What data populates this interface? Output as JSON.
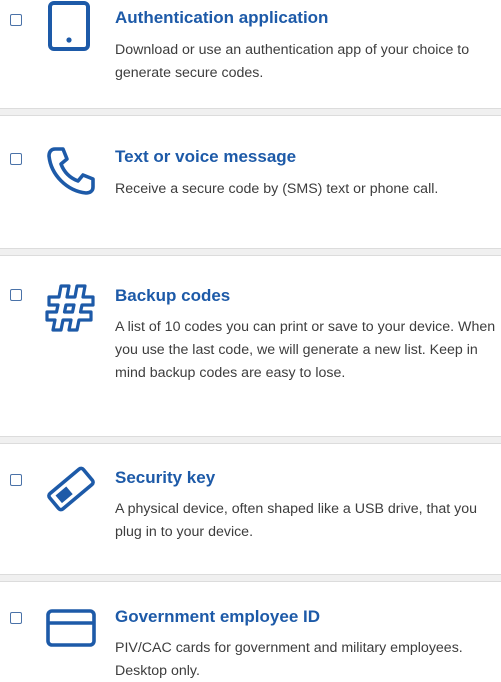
{
  "options": [
    {
      "title": "Authentication application",
      "description": "Download or use an authentication app of your choice to generate secure codes.",
      "icon": "tablet-icon"
    },
    {
      "title": "Text or voice message",
      "description": "Receive a secure code by (SMS) text or phone call.",
      "icon": "phone-icon"
    },
    {
      "title": "Backup codes",
      "description": "A list of 10 codes you can print or save to your device. When you use the last code, we will generate a new list. Keep in mind backup codes are easy to lose.",
      "icon": "hash-icon"
    },
    {
      "title": "Security key",
      "description": "A physical device, often shaped like a USB drive, that you plug in to your device.",
      "icon": "security-key-icon"
    },
    {
      "title": "Government employee ID",
      "description": "PIV/CAC cards for government and military employees. Desktop only.",
      "icon": "id-card-icon"
    }
  ],
  "colors": {
    "accent": "#1d5aa8",
    "text": "#3d3d3d",
    "divider": "#f0f0f0"
  }
}
